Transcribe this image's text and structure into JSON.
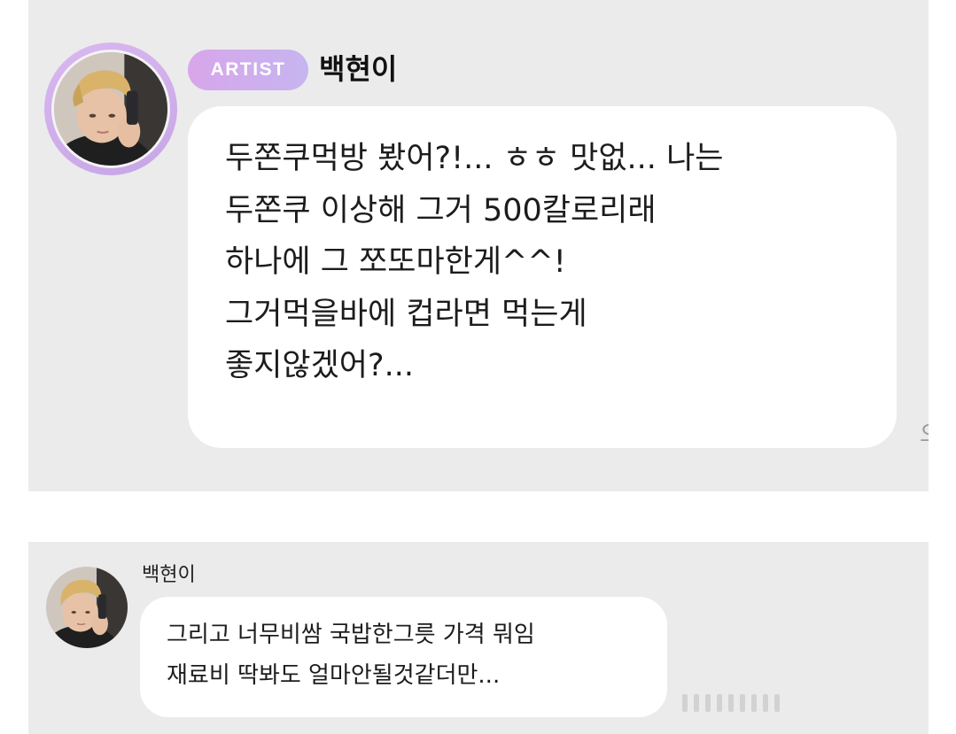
{
  "top_message": {
    "badge": "ARTIST",
    "sender": "백현이",
    "avatar": "profile-photo",
    "lines": [
      "두쫀쿠먹방 봤어?!... ㅎㅎ 맛없... 나는",
      "두쫀쿠 이상해 그거 500칼로리래",
      "하나에 그 쪼또마한게^^!",
      "그거먹을바에 컵라면 먹는게",
      "좋지않겠어?..."
    ],
    "edge_glyph": "오"
  },
  "bottom_message": {
    "sender": "백현이",
    "avatar": "profile-photo",
    "lines": [
      "그리고 너무비쌈 국밥한그릇 가격 뭐임",
      "재료비 딱봐도 얼마안될것같더만..."
    ]
  },
  "colors": {
    "panel_background": "#ebebeb",
    "bubble_background": "#ffffff",
    "badge_gradient_start": "#d8a6ea",
    "badge_gradient_end": "#c6b5f0",
    "avatar_ring": "#d9b8f0",
    "text": "#1c1c1c"
  }
}
